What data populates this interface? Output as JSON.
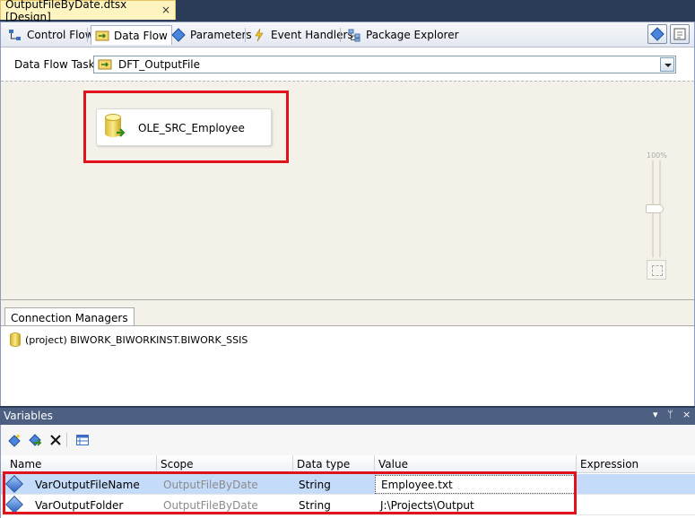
{
  "document_tab": {
    "title": "OutputFileByDate.dtsx [Design]",
    "close_glyph": "×"
  },
  "designer_tabs": [
    {
      "label": "Control Flow",
      "icon": "control-flow-icon"
    },
    {
      "label": "Data Flow",
      "icon": "data-flow-icon",
      "active": true
    },
    {
      "label": "Parameters",
      "icon": "parameters-icon"
    },
    {
      "label": "Event Handlers",
      "icon": "event-handlers-icon"
    },
    {
      "label": "Package Explorer",
      "icon": "package-explorer-icon"
    }
  ],
  "task": {
    "label": "Data Flow Task:",
    "value": "DFT_OutputFile"
  },
  "canvas": {
    "component_name": "OLE_SRC_Employee",
    "zoom_label": "100%"
  },
  "connection_managers": {
    "tab_label": "Connection Managers",
    "items": [
      "(project) BIWORK_BIWORKINST.BIWORK_SSIS"
    ]
  },
  "variables": {
    "title": "Variables",
    "window_controls": [
      "▾",
      "ᛘ",
      "×"
    ],
    "columns": [
      "Name",
      "Scope",
      "Data type",
      "Value",
      "Expression"
    ],
    "rows": [
      {
        "name": "VarOutputFileName",
        "scope": "OutputFileByDate",
        "type": "String",
        "value": "Employee.txt",
        "expression": ""
      },
      {
        "name": "VarOutputFolder",
        "scope": "OutputFileByDate",
        "type": "String",
        "value": "J:\\Projects\\Output",
        "expression": ""
      }
    ]
  },
  "colors": {
    "highlight": "#e0121b",
    "titlebar": "#4d6082",
    "selection": "#c4dcfa"
  }
}
